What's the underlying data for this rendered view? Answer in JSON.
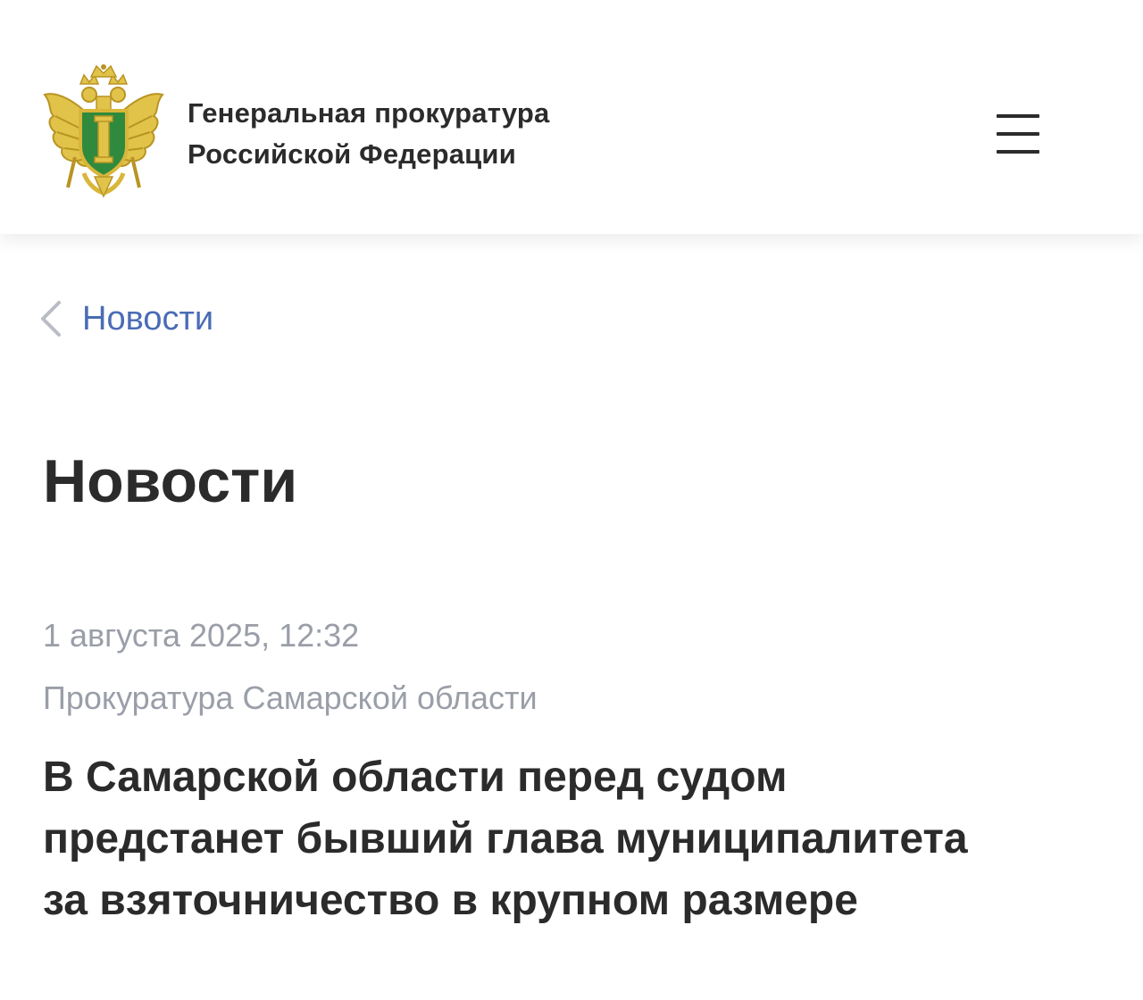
{
  "header": {
    "org_name_line1": "Генеральная прокуратура",
    "org_name_line2": "Российской Федерации",
    "emblem_icon": "prosecutor-emblem-icon",
    "menu_icon": "hamburger-menu-icon"
  },
  "breadcrumb": {
    "back_icon": "chevron-left-icon",
    "label": "Новости"
  },
  "page": {
    "title": "Новости"
  },
  "article": {
    "date": "1 августа 2025, 12:32",
    "source": "Прокуратура Самарской области",
    "title_lines": [
      "В Самарской области перед судом",
      "предстанет бывший глава муниципалитета",
      "за взяточничество в крупном размере"
    ]
  },
  "colors": {
    "link": "#4a6cb5",
    "text": "#2b2b2b",
    "muted": "#9a9ea8",
    "emblem_gold": "#d9b63a",
    "emblem_green": "#2f8a3e"
  }
}
